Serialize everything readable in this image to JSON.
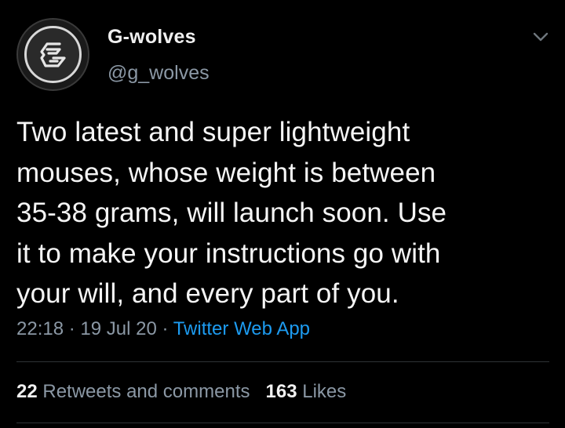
{
  "tweet": {
    "author": {
      "display_name": "G-wolves",
      "handle": "@g_wolves",
      "avatar_icon": "g-wolves-logo-icon"
    },
    "menu_icon": "chevron-down-icon",
    "text": "Two latest and super lightweight\nmouses, whose weight is between\n35-38 grams, will launch soon. Use\nit to make your instructions go with\nyour will, and every part of you.",
    "time": "22:18",
    "separator": "·",
    "date": "19 Jul 20",
    "source": "Twitter Web App",
    "stats": {
      "retweets_count": "22",
      "retweets_label": "Retweets and comments",
      "likes_count": "163",
      "likes_label": "Likes"
    }
  },
  "colors": {
    "background": "#000000",
    "text": "#f5f5f5",
    "secondary_text": "#8b98a5",
    "link": "#1d9bf0",
    "divider": "#2f3336"
  }
}
